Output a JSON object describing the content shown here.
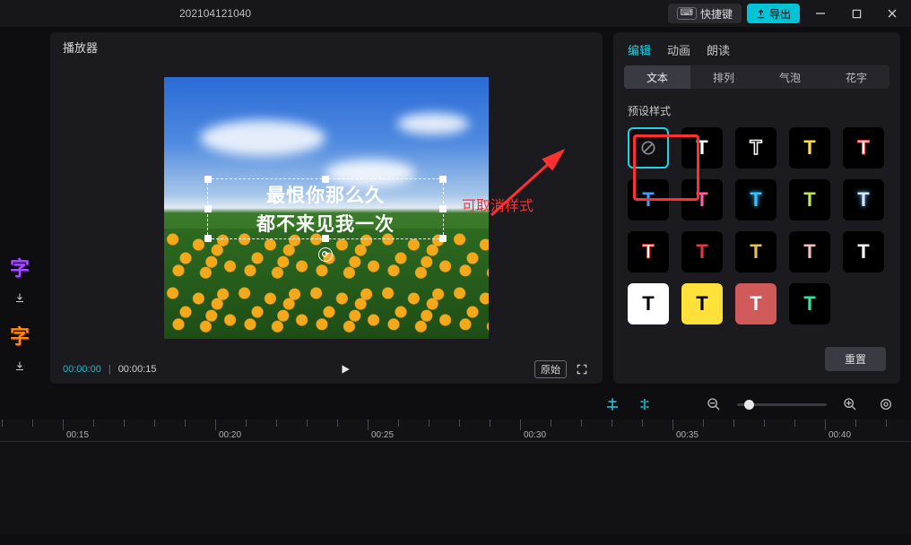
{
  "header": {
    "project_name": "202104121040",
    "shortcut_button": "快捷键",
    "export_button": "导出"
  },
  "player": {
    "title": "播放器",
    "text_line1": "最恨你那么久",
    "text_line2": "都不来见我一次",
    "time_current": "00:00:00",
    "time_total": "00:00:15",
    "ratio_label": "原始"
  },
  "annotation": {
    "text": "可取消样式"
  },
  "inspector": {
    "top_tabs": [
      "编辑",
      "动画",
      "朗读"
    ],
    "top_active": 0,
    "sub_tabs": [
      "文本",
      "排列",
      "气泡",
      "花字"
    ],
    "sub_active": 0,
    "section_label": "预设样式",
    "reset_label": "重置"
  },
  "timeline": {
    "ticks": [
      "00:15",
      "00:20",
      "00:25",
      "00:30",
      "00:35",
      "00:40"
    ]
  },
  "presets": [
    {
      "kind": "none"
    },
    {
      "fg": "#ffffff",
      "bg": "#000000"
    },
    {
      "fg": "transparent",
      "bg": "#000000",
      "outline": "#ffffff"
    },
    {
      "fg": "#ffe13a",
      "bg": "#000000"
    },
    {
      "fg": "#ffffff",
      "bg": "#000000",
      "outline": "#ff3b3b",
      "ow": "1px"
    },
    {
      "fg": "#3aa0ff",
      "bg": "#000000"
    },
    {
      "fg": "#ff5fa8",
      "bg": "#000000"
    },
    {
      "fg": "#39c0ff",
      "bg": "#000000",
      "shadow": "0 0 6px #39c0ff"
    },
    {
      "fg": "#c3e64b",
      "bg": "#000000"
    },
    {
      "fg": "#cfe8ff",
      "bg": "#000000",
      "shadow": "0 0 6px #6bb8ff"
    },
    {
      "fg": "#ffffff",
      "bg": "#000000",
      "outline": "#e02828",
      "ow": "1px"
    },
    {
      "fg": "#e23b3b",
      "bg": "#000000"
    },
    {
      "fg": "#e8c24a",
      "bg": "#000000"
    },
    {
      "fg": "#f5bdbd",
      "bg": "#000000"
    },
    {
      "fg": "#ffffff",
      "bg": "#000000",
      "plain": true
    },
    {
      "fg": "#000000",
      "bg": "#ffffff"
    },
    {
      "fg": "#000000",
      "bg": "#ffe13a"
    },
    {
      "fg": "#ffffff",
      "bg": "#d05a5a"
    },
    {
      "fg": "#2fe6a5",
      "bg": "#000000"
    }
  ]
}
